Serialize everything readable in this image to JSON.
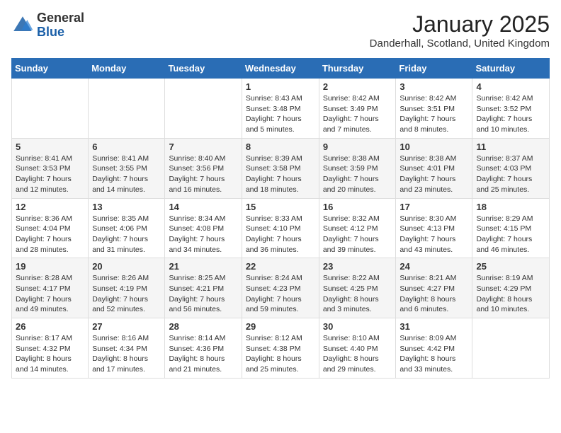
{
  "header": {
    "logo": {
      "general": "General",
      "blue": "Blue"
    },
    "title": "January 2025",
    "subtitle": "Danderhall, Scotland, United Kingdom"
  },
  "calendar": {
    "days_of_week": [
      "Sunday",
      "Monday",
      "Tuesday",
      "Wednesday",
      "Thursday",
      "Friday",
      "Saturday"
    ],
    "weeks": [
      [
        {
          "day": "",
          "sunrise": "",
          "sunset": "",
          "daylight": ""
        },
        {
          "day": "",
          "sunrise": "",
          "sunset": "",
          "daylight": ""
        },
        {
          "day": "",
          "sunrise": "",
          "sunset": "",
          "daylight": ""
        },
        {
          "day": "1",
          "sunrise": "Sunrise: 8:43 AM",
          "sunset": "Sunset: 3:48 PM",
          "daylight": "Daylight: 7 hours and 5 minutes."
        },
        {
          "day": "2",
          "sunrise": "Sunrise: 8:42 AM",
          "sunset": "Sunset: 3:49 PM",
          "daylight": "Daylight: 7 hours and 7 minutes."
        },
        {
          "day": "3",
          "sunrise": "Sunrise: 8:42 AM",
          "sunset": "Sunset: 3:51 PM",
          "daylight": "Daylight: 7 hours and 8 minutes."
        },
        {
          "day": "4",
          "sunrise": "Sunrise: 8:42 AM",
          "sunset": "Sunset: 3:52 PM",
          "daylight": "Daylight: 7 hours and 10 minutes."
        }
      ],
      [
        {
          "day": "5",
          "sunrise": "Sunrise: 8:41 AM",
          "sunset": "Sunset: 3:53 PM",
          "daylight": "Daylight: 7 hours and 12 minutes."
        },
        {
          "day": "6",
          "sunrise": "Sunrise: 8:41 AM",
          "sunset": "Sunset: 3:55 PM",
          "daylight": "Daylight: 7 hours and 14 minutes."
        },
        {
          "day": "7",
          "sunrise": "Sunrise: 8:40 AM",
          "sunset": "Sunset: 3:56 PM",
          "daylight": "Daylight: 7 hours and 16 minutes."
        },
        {
          "day": "8",
          "sunrise": "Sunrise: 8:39 AM",
          "sunset": "Sunset: 3:58 PM",
          "daylight": "Daylight: 7 hours and 18 minutes."
        },
        {
          "day": "9",
          "sunrise": "Sunrise: 8:38 AM",
          "sunset": "Sunset: 3:59 PM",
          "daylight": "Daylight: 7 hours and 20 minutes."
        },
        {
          "day": "10",
          "sunrise": "Sunrise: 8:38 AM",
          "sunset": "Sunset: 4:01 PM",
          "daylight": "Daylight: 7 hours and 23 minutes."
        },
        {
          "day": "11",
          "sunrise": "Sunrise: 8:37 AM",
          "sunset": "Sunset: 4:03 PM",
          "daylight": "Daylight: 7 hours and 25 minutes."
        }
      ],
      [
        {
          "day": "12",
          "sunrise": "Sunrise: 8:36 AM",
          "sunset": "Sunset: 4:04 PM",
          "daylight": "Daylight: 7 hours and 28 minutes."
        },
        {
          "day": "13",
          "sunrise": "Sunrise: 8:35 AM",
          "sunset": "Sunset: 4:06 PM",
          "daylight": "Daylight: 7 hours and 31 minutes."
        },
        {
          "day": "14",
          "sunrise": "Sunrise: 8:34 AM",
          "sunset": "Sunset: 4:08 PM",
          "daylight": "Daylight: 7 hours and 34 minutes."
        },
        {
          "day": "15",
          "sunrise": "Sunrise: 8:33 AM",
          "sunset": "Sunset: 4:10 PM",
          "daylight": "Daylight: 7 hours and 36 minutes."
        },
        {
          "day": "16",
          "sunrise": "Sunrise: 8:32 AM",
          "sunset": "Sunset: 4:12 PM",
          "daylight": "Daylight: 7 hours and 39 minutes."
        },
        {
          "day": "17",
          "sunrise": "Sunrise: 8:30 AM",
          "sunset": "Sunset: 4:13 PM",
          "daylight": "Daylight: 7 hours and 43 minutes."
        },
        {
          "day": "18",
          "sunrise": "Sunrise: 8:29 AM",
          "sunset": "Sunset: 4:15 PM",
          "daylight": "Daylight: 7 hours and 46 minutes."
        }
      ],
      [
        {
          "day": "19",
          "sunrise": "Sunrise: 8:28 AM",
          "sunset": "Sunset: 4:17 PM",
          "daylight": "Daylight: 7 hours and 49 minutes."
        },
        {
          "day": "20",
          "sunrise": "Sunrise: 8:26 AM",
          "sunset": "Sunset: 4:19 PM",
          "daylight": "Daylight: 7 hours and 52 minutes."
        },
        {
          "day": "21",
          "sunrise": "Sunrise: 8:25 AM",
          "sunset": "Sunset: 4:21 PM",
          "daylight": "Daylight: 7 hours and 56 minutes."
        },
        {
          "day": "22",
          "sunrise": "Sunrise: 8:24 AM",
          "sunset": "Sunset: 4:23 PM",
          "daylight": "Daylight: 7 hours and 59 minutes."
        },
        {
          "day": "23",
          "sunrise": "Sunrise: 8:22 AM",
          "sunset": "Sunset: 4:25 PM",
          "daylight": "Daylight: 8 hours and 3 minutes."
        },
        {
          "day": "24",
          "sunrise": "Sunrise: 8:21 AM",
          "sunset": "Sunset: 4:27 PM",
          "daylight": "Daylight: 8 hours and 6 minutes."
        },
        {
          "day": "25",
          "sunrise": "Sunrise: 8:19 AM",
          "sunset": "Sunset: 4:29 PM",
          "daylight": "Daylight: 8 hours and 10 minutes."
        }
      ],
      [
        {
          "day": "26",
          "sunrise": "Sunrise: 8:17 AM",
          "sunset": "Sunset: 4:32 PM",
          "daylight": "Daylight: 8 hours and 14 minutes."
        },
        {
          "day": "27",
          "sunrise": "Sunrise: 8:16 AM",
          "sunset": "Sunset: 4:34 PM",
          "daylight": "Daylight: 8 hours and 17 minutes."
        },
        {
          "day": "28",
          "sunrise": "Sunrise: 8:14 AM",
          "sunset": "Sunset: 4:36 PM",
          "daylight": "Daylight: 8 hours and 21 minutes."
        },
        {
          "day": "29",
          "sunrise": "Sunrise: 8:12 AM",
          "sunset": "Sunset: 4:38 PM",
          "daylight": "Daylight: 8 hours and 25 minutes."
        },
        {
          "day": "30",
          "sunrise": "Sunrise: 8:10 AM",
          "sunset": "Sunset: 4:40 PM",
          "daylight": "Daylight: 8 hours and 29 minutes."
        },
        {
          "day": "31",
          "sunrise": "Sunrise: 8:09 AM",
          "sunset": "Sunset: 4:42 PM",
          "daylight": "Daylight: 8 hours and 33 minutes."
        },
        {
          "day": "",
          "sunrise": "",
          "sunset": "",
          "daylight": ""
        }
      ]
    ]
  }
}
